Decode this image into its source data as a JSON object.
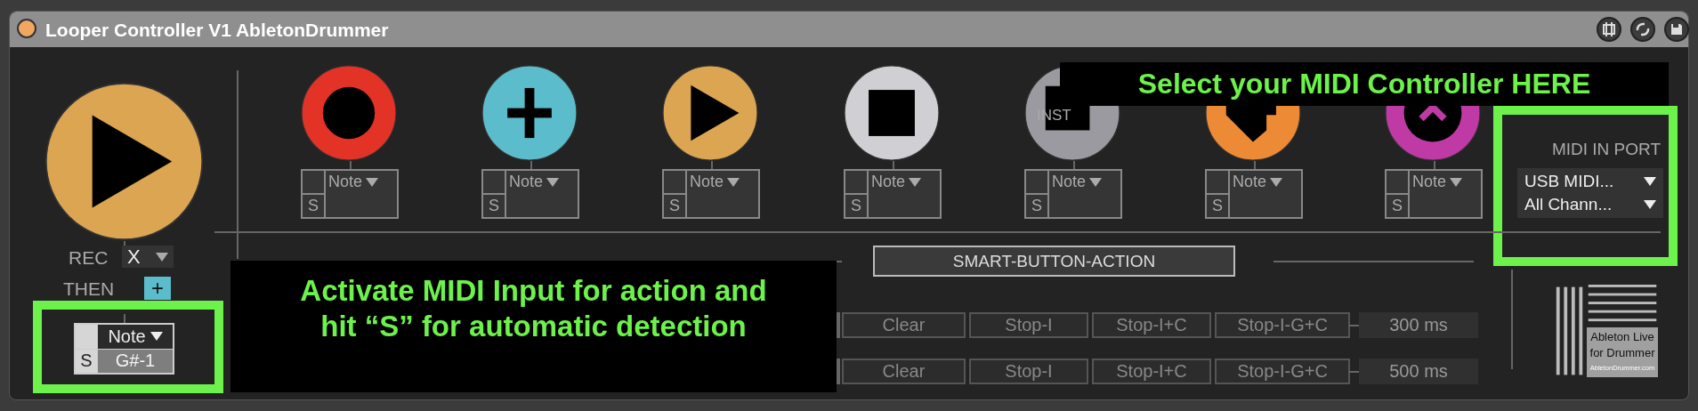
{
  "window": {
    "title": "Looper Controller V1 AbletonDrummer"
  },
  "main_button": {
    "kind": "play",
    "color": "#dba552",
    "learn": "S",
    "type": "Note",
    "value": "G#-1"
  },
  "rec": {
    "label": "REC",
    "value": "X"
  },
  "then": {
    "label": "THEN",
    "value": "+"
  },
  "pads": [
    {
      "kind": "record",
      "color": "#e33226",
      "learn": "S",
      "type": "Note"
    },
    {
      "kind": "add",
      "color": "#5bbccc",
      "learn": "S",
      "type": "Note"
    },
    {
      "kind": "play",
      "color": "#dba552",
      "learn": "S",
      "type": "Note"
    },
    {
      "kind": "stop",
      "color": "#cfcfd4",
      "learn": "S",
      "type": "Note"
    },
    {
      "kind": "inst",
      "color": "#9a9aa0",
      "label": "INST",
      "learn": "S",
      "type": "Note"
    },
    {
      "kind": "notch",
      "color": "#ec8a35",
      "learn": "S",
      "type": "Note"
    },
    {
      "kind": "ring",
      "color": "#c03aa6",
      "learn": "S",
      "type": "Note"
    }
  ],
  "midi_in": {
    "label": "MIDI IN PORT",
    "port": "USB MIDI...",
    "channel": "All Chann..."
  },
  "smart_button": {
    "label": "SMART-BUTTON-ACTION"
  },
  "action_rows": [
    {
      "buttons": [
        "Clear",
        "Stop-I",
        "Stop-I+C",
        "Stop-I-G+C"
      ],
      "time": "300 ms"
    },
    {
      "buttons": [
        "Clear",
        "Stop-I",
        "Stop-I+C",
        "Stop-I-G+C"
      ],
      "time": "500 ms"
    }
  ],
  "logo": {
    "title": "Ableton Live",
    "subtitle": "for Drummer",
    "url": "AbletonDrummer.com"
  },
  "annotations": [
    {
      "text": "Select your MIDI Controller HERE"
    },
    {
      "text": "Activate MIDI Input for action and hit “S” for automatic detection"
    }
  ]
}
